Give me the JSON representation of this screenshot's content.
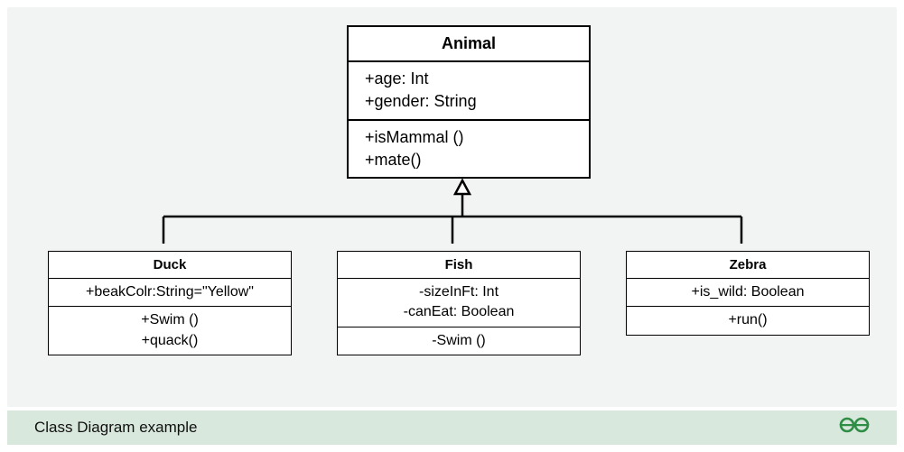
{
  "footer": {
    "title": "Class Diagram example",
    "logo_name": "geeksforgeeks-logo"
  },
  "classes": {
    "animal": {
      "name": "Animal",
      "attributes": [
        "+age: Int",
        "+gender: String"
      ],
      "methods": [
        "+isMammal ()",
        "+mate()"
      ]
    },
    "duck": {
      "name": "Duck",
      "attributes": [
        "+beakColr:String=\"Yellow\""
      ],
      "methods": [
        "+Swim ()",
        "+quack()"
      ]
    },
    "fish": {
      "name": "Fish",
      "attributes": [
        "-sizeInFt: Int",
        "-canEat: Boolean"
      ],
      "methods": [
        "-Swim ()"
      ]
    },
    "zebra": {
      "name": "Zebra",
      "attributes": [
        "+is_wild: Boolean"
      ],
      "methods": [
        "+run()"
      ]
    }
  },
  "inheritance": {
    "parent": "animal",
    "children": [
      "duck",
      "fish",
      "zebra"
    ]
  }
}
